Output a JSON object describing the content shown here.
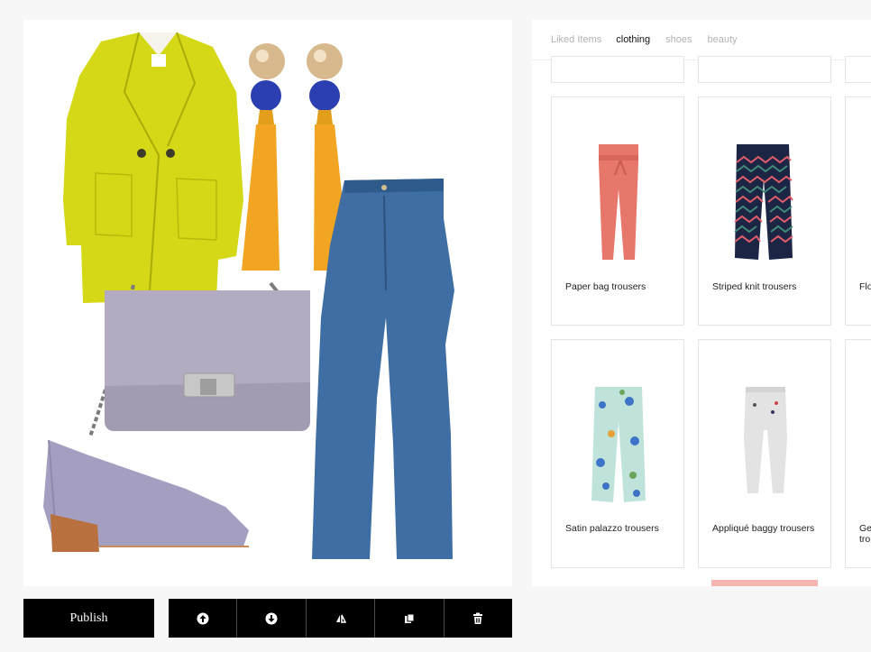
{
  "tabs": [
    {
      "label": "Liked Items",
      "active": false
    },
    {
      "label": "clothing",
      "active": true
    },
    {
      "label": "shoes",
      "active": false
    },
    {
      "label": "beauty",
      "active": false
    }
  ],
  "products": [
    {
      "name": "Paper bag trousers",
      "color": "#e8776b"
    },
    {
      "name": "Striped knit trousers",
      "color": "#1d2545"
    },
    {
      "name": "Flo",
      "color": "#d0d0d0"
    },
    {
      "name": "Satin palazzo trousers",
      "color": "#bfe3db"
    },
    {
      "name": "Appliqué baggy trousers",
      "color": "#e3e3e3"
    },
    {
      "name": "Ge tro",
      "color": "#d0d0d0"
    }
  ],
  "toolbar": {
    "publish_label": "Publish",
    "buttons": [
      {
        "icon": "bring-forward-icon"
      },
      {
        "icon": "send-backward-icon"
      },
      {
        "icon": "flip-icon"
      },
      {
        "icon": "duplicate-icon"
      },
      {
        "icon": "trash-icon"
      }
    ]
  },
  "canvas_items": [
    {
      "item": "yellow coat",
      "color": "#d4d816"
    },
    {
      "item": "tassel earrings",
      "color": "#f1a522"
    },
    {
      "item": "lilac chain bag",
      "color": "#a39bb1"
    },
    {
      "item": "flared jeans",
      "color": "#3f6ea4"
    },
    {
      "item": "lilac heeled shoe",
      "color": "#a49fc0"
    }
  ]
}
